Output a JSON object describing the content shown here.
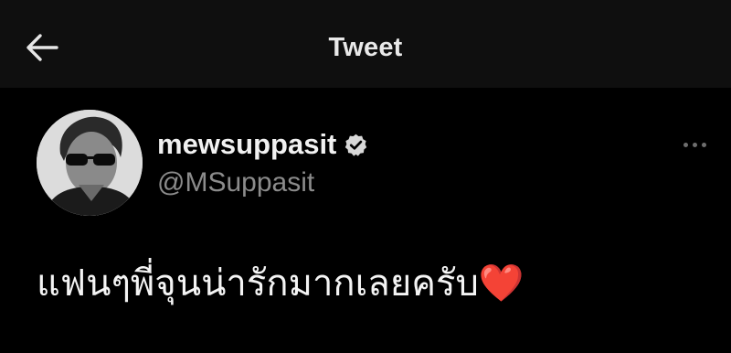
{
  "header": {
    "title": "Tweet",
    "back_icon": "arrow-left-icon"
  },
  "tweet": {
    "display_name": "mewsuppasit",
    "verified_icon": "verified-badge-icon",
    "handle": "@MSuppasit",
    "more_icon": "more-horizontal-icon",
    "text": "แฟนๆพี่จุนน่ารักมากเลยครับ❤️"
  },
  "colors": {
    "header_bg": "#0f0f0f",
    "background": "#000000",
    "primary_text": "#f1f1f1",
    "secondary_text": "#8b8b8b",
    "heart": "#e0222b"
  }
}
